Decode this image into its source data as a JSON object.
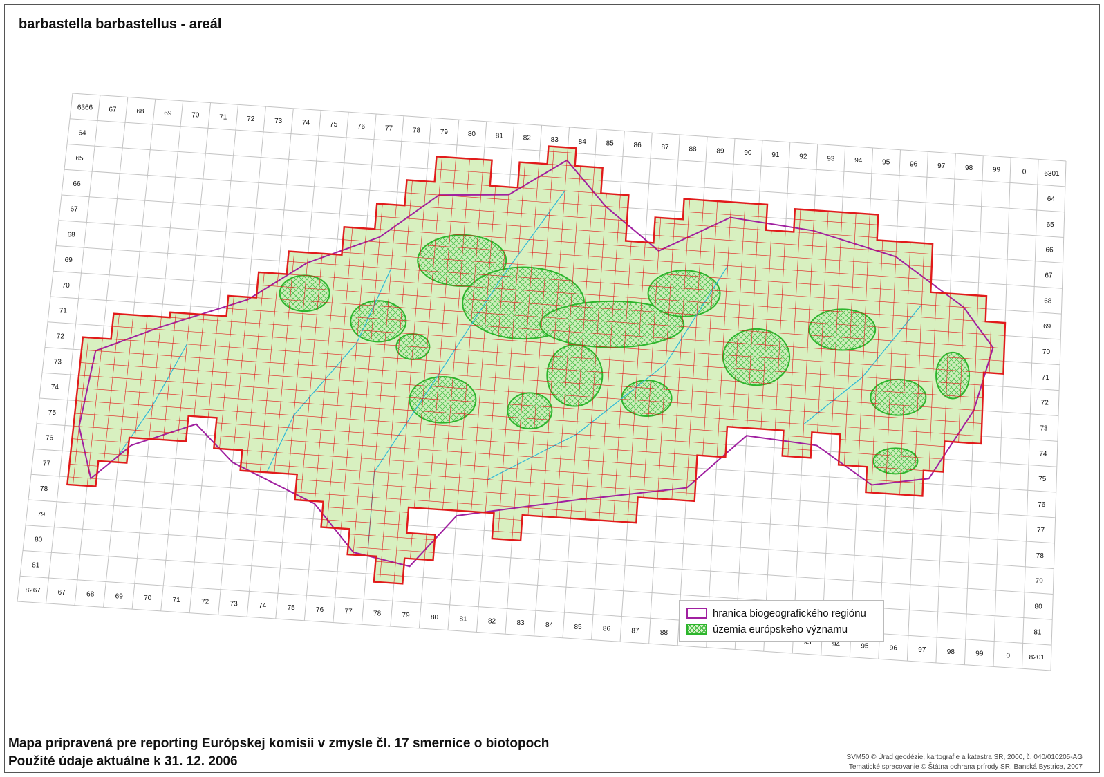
{
  "map": {
    "title": "barbastella barbastellus - areál",
    "corners": {
      "top_left": "6366",
      "top_right": "6301",
      "bottom_left": "8267",
      "bottom_right": "8201"
    },
    "column_labels": [
      "67",
      "68",
      "69",
      "70",
      "71",
      "72",
      "73",
      "74",
      "75",
      "76",
      "77",
      "78",
      "79",
      "80",
      "81",
      "82",
      "83",
      "84",
      "85",
      "86",
      "87",
      "88",
      "89",
      "90",
      "91",
      "92",
      "93",
      "94",
      "95",
      "96",
      "97",
      "98",
      "99",
      "0"
    ],
    "left_row_labels": [
      "64",
      "65",
      "66",
      "67",
      "68",
      "69",
      "70",
      "71",
      "72",
      "73",
      "74",
      "75",
      "76",
      "77",
      "78",
      "79",
      "80",
      "81"
    ],
    "right_row_labels": [
      "64",
      "65",
      "66",
      "67",
      "68",
      "69",
      "70",
      "71",
      "72",
      "73",
      "74",
      "75",
      "76",
      "77",
      "78",
      "79",
      "80",
      "81"
    ],
    "colors": {
      "grid": "#c4c4c4",
      "range": "#e11b1b",
      "biogeo": "#a020a0",
      "sites": "#2cb52c",
      "fill": "#d8f0c0",
      "water": "#30b8d8"
    }
  },
  "legend": {
    "items": [
      {
        "label": "hranica biogeografického regiónu",
        "icon": "purple-outline-swatch"
      },
      {
        "label": "územia európskeho významu",
        "icon": "green-hatched-swatch"
      }
    ]
  },
  "footer": {
    "line1": "Mapa pripravená pre reporting Európskej komisii v zmysle čl. 17 smernice o biotopoch",
    "line2": "Použité údaje aktuálne k 31. 12. 2006"
  },
  "credits": {
    "line1": "SVM50 © Úrad geodézie, kartografie a katastra SR, 2000, č. 040/010205-AG",
    "line2": "Tematické spracovanie © Štátna ochrana prírody SR, Banská Bystrica, 2007"
  }
}
